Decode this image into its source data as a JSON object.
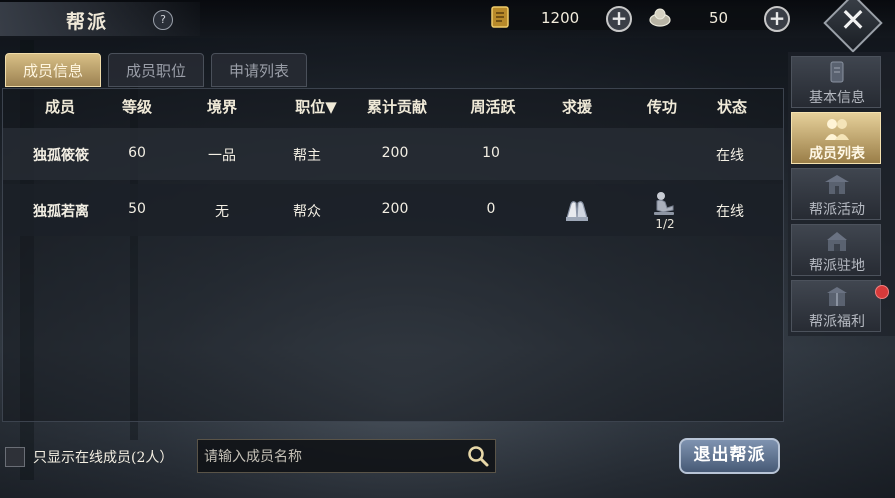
{
  "header": {
    "title": "帮派",
    "help_icon": "question-icon",
    "currency_gold": {
      "icon": "gold-scroll-icon",
      "value": "1200"
    },
    "currency_silver": {
      "icon": "silver-ingot-icon",
      "value": "50"
    }
  },
  "tabs": [
    {
      "label": "成员信息",
      "active": true
    },
    {
      "label": "成员职位",
      "active": false
    },
    {
      "label": "申请列表",
      "active": false
    }
  ],
  "table": {
    "headers": [
      "成员",
      "等级",
      "境界",
      "职位",
      "累计贡献",
      "周活跃",
      "求援",
      "传功",
      "状态"
    ],
    "sort_indicator": "▼",
    "rows": [
      {
        "name": "独孤筱筱",
        "level": "60",
        "realm": "一品",
        "position": "帮主",
        "contribution": "200",
        "weekly": "10",
        "help": "",
        "transfer": "",
        "status": "在线"
      },
      {
        "name": "独孤若离",
        "level": "50",
        "realm": "无",
        "position": "帮众",
        "contribution": "200",
        "weekly": "0",
        "help_icon": "fist-salute-icon",
        "transfer_icon": "meditate-icon",
        "transfer_count": "1/2",
        "status": "在线"
      }
    ]
  },
  "side_nav": [
    {
      "label": "基本信息",
      "active": false,
      "icon": "info-icon"
    },
    {
      "label": "成员列表",
      "active": true,
      "icon": "members-icon"
    },
    {
      "label": "帮派活动",
      "active": false,
      "icon": "pavilion-icon"
    },
    {
      "label": "帮派驻地",
      "active": false,
      "icon": "castle-icon"
    },
    {
      "label": "帮派福利",
      "active": false,
      "icon": "gift-icon",
      "badge": true
    }
  ],
  "footer": {
    "online_only_label": "只显示在线成员(2人）",
    "search_placeholder": "请输入成员名称",
    "quit_label": "退出帮派"
  },
  "colors": {
    "accent_gold": "#d8bf86",
    "badge_red": "#d83a3a",
    "button_blue": "#6a7f9e"
  }
}
